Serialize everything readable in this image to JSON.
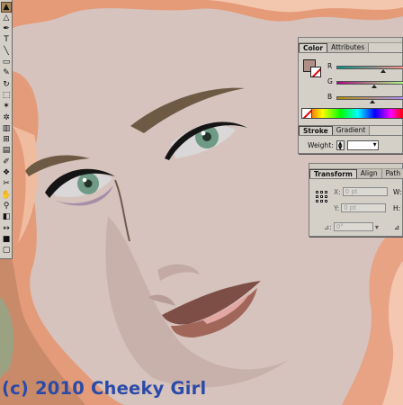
{
  "tools": [
    {
      "name": "selection-tool",
      "glyph": "▲"
    },
    {
      "name": "direct-selection-tool",
      "glyph": "△"
    },
    {
      "name": "pen-tool",
      "glyph": "✒"
    },
    {
      "name": "type-tool",
      "glyph": "T"
    },
    {
      "name": "line-tool",
      "glyph": "╲"
    },
    {
      "name": "rectangle-tool",
      "glyph": "▭"
    },
    {
      "name": "pencil-tool",
      "glyph": "✎"
    },
    {
      "name": "rotate-tool",
      "glyph": "↻"
    },
    {
      "name": "scale-tool",
      "glyph": "⬚"
    },
    {
      "name": "warp-tool",
      "glyph": "✶"
    },
    {
      "name": "symbol-tool",
      "glyph": "✲"
    },
    {
      "name": "graph-tool",
      "glyph": "▥"
    },
    {
      "name": "mesh-tool",
      "glyph": "⊞"
    },
    {
      "name": "gradient-tool",
      "glyph": "▤"
    },
    {
      "name": "eyedropper-tool",
      "glyph": "✐"
    },
    {
      "name": "blend-tool",
      "glyph": "❖"
    },
    {
      "name": "scissors-tool",
      "glyph": "✂"
    },
    {
      "name": "hand-tool",
      "glyph": "✋"
    },
    {
      "name": "zoom-tool",
      "glyph": "⚲"
    },
    {
      "name": "fill-stroke-swatch",
      "glyph": "◧"
    },
    {
      "name": "swap-colors",
      "glyph": "↔"
    },
    {
      "name": "color-mode",
      "glyph": "■"
    },
    {
      "name": "screen-mode",
      "glyph": "▢"
    }
  ],
  "color_panel": {
    "tabs": [
      "Color",
      "Attributes"
    ],
    "active_tab": "Color",
    "fill_color": "#b08f86",
    "sliders": [
      {
        "label": "R",
        "value": 0.69
      },
      {
        "label": "G",
        "value": 0.56
      },
      {
        "label": "B",
        "value": 0.53
      }
    ]
  },
  "stroke_panel": {
    "tabs": [
      "Stroke",
      "Gradient"
    ],
    "active_tab": "Stroke",
    "weight_label": "Weight:"
  },
  "transform_panel": {
    "tabs": [
      "Transform",
      "Align",
      "Path"
    ],
    "active_tab": "Transform",
    "x_label": "X:",
    "x_value": "0 pt",
    "y_label": "Y:",
    "y_value": "0 pt",
    "w_label": "W:",
    "h_label": "H:",
    "angle_value": "0°"
  },
  "watermark": "(c) 2010 Cheeky Girl",
  "colors": {
    "skin": "#d6c3bd",
    "hair": "#e8a07e",
    "hair_light": "#f2c2a8",
    "eyebrow": "#6e5a44",
    "iris": "#6f9a86",
    "lips": "#8a5a50",
    "accent": "#2a4aa8"
  }
}
